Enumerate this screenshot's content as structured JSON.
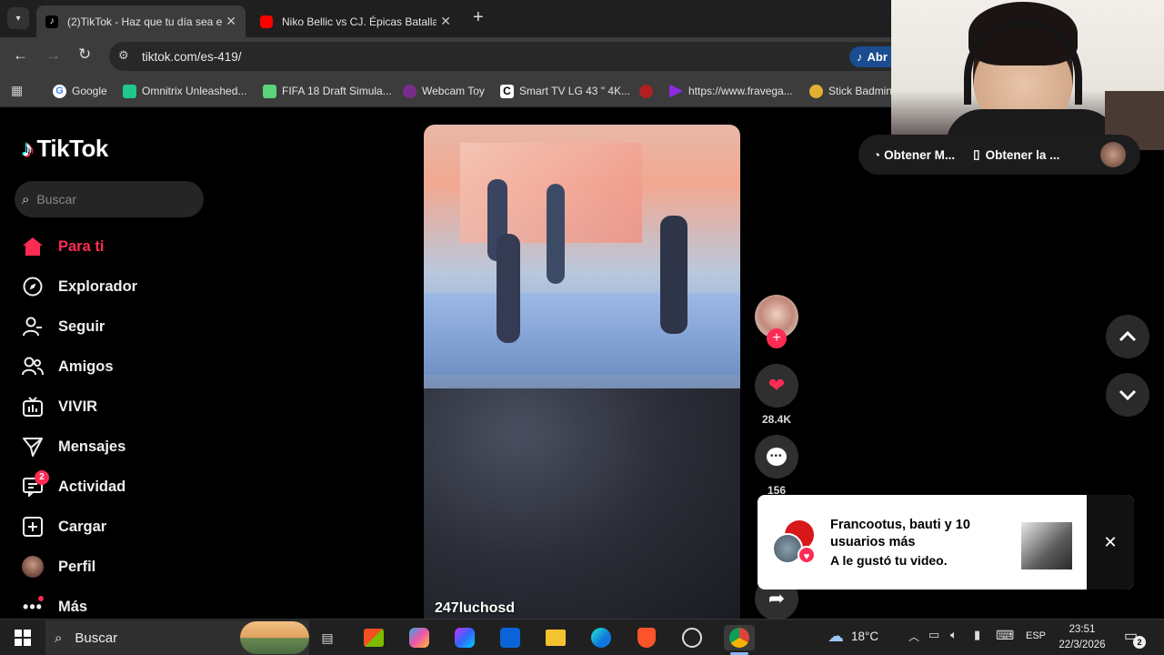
{
  "browser": {
    "tabs": [
      {
        "title": "(2)TikTok - Haz que tu día sea e",
        "close": "✕"
      },
      {
        "title": "Niko Bellic vs CJ. Épicas Batallas",
        "close": "✕"
      }
    ],
    "new_tab": "+",
    "url": "tiktok.com/es-419/",
    "open_app_label": "Abr",
    "bookmarks": [
      {
        "label": "Google",
        "color": "#ffffff"
      },
      {
        "label": "Omnitrix Unleashed...",
        "color": "#1ec98b"
      },
      {
        "label": "FIFA 18 Draft Simula...",
        "color": "#5ad37a"
      },
      {
        "label": "Webcam Toy",
        "color": "#7a2c8c"
      },
      {
        "label": "Smart TV LG 43 \" 4K...",
        "color": "#ffffff"
      },
      {
        "label": "",
        "color": "#b02020"
      },
      {
        "label": "https://www.fravega...",
        "color": "#8a2be2"
      },
      {
        "label": "Stick Badmin",
        "color": "#e0b030"
      }
    ]
  },
  "tiktok": {
    "logo": "TikTok",
    "search_placeholder": "Buscar",
    "nav": [
      {
        "label": "Para ti",
        "icon": "home-icon",
        "active": true
      },
      {
        "label": "Explorador",
        "icon": "compass-icon"
      },
      {
        "label": "Seguir",
        "icon": "following-icon"
      },
      {
        "label": "Amigos",
        "icon": "friends-icon"
      },
      {
        "label": "VIVIR",
        "icon": "live-icon"
      },
      {
        "label": "Mensajes",
        "icon": "messages-icon"
      },
      {
        "label": "Actividad",
        "icon": "activity-icon",
        "badge": "2"
      },
      {
        "label": "Cargar",
        "icon": "upload-icon"
      },
      {
        "label": "Perfil",
        "icon": "avatar"
      },
      {
        "label": "Más",
        "icon": "more-icon"
      }
    ],
    "top_actions": [
      "Obtener M...",
      "Obtener la ..."
    ],
    "video": {
      "username": "247luchosd"
    },
    "likes": "28.4K",
    "comments": "156",
    "accent": "#fe2c55"
  },
  "notification": {
    "title": "Francootus, bauti y 10 usuarios más",
    "subtitle": "A le gustó tu video."
  },
  "taskbar": {
    "search": "Buscar",
    "temperature": "18°C",
    "lang": "ESP",
    "time": "23:51",
    "date": "22/3/2026",
    "notif_count": "2"
  }
}
